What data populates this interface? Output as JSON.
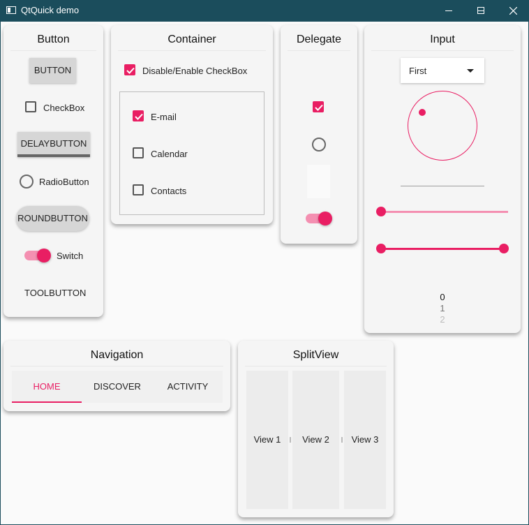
{
  "window": {
    "title": "QtQuick demo"
  },
  "colors": {
    "accent": "#e91e63",
    "accent_light": "#f48fb1",
    "titlebar": "#1b4d5c"
  },
  "icons": {
    "app": "app-window-icon",
    "minimize": "minimize-icon",
    "maximize": "maximize-icon",
    "close": "close-icon",
    "checkmark": "checkmark-icon",
    "dropdown": "caret-down-icon"
  },
  "button_card": {
    "title": "Button",
    "button_label": "BUTTON",
    "checkbox_label": "CheckBox",
    "delay_button_label": "DELAYBUTTON",
    "radio_label": "RadioButton",
    "round_button_label": "ROUNDBUTTON",
    "switch_label": "Switch",
    "tool_button_label": "TOOLBUTTON"
  },
  "container_card": {
    "title": "Container",
    "master_checkbox_label": "Disable/Enable CheckBox",
    "items": [
      {
        "label": "E-mail",
        "checked": true
      },
      {
        "label": "Calendar",
        "checked": false
      },
      {
        "label": "Contacts",
        "checked": false
      }
    ]
  },
  "delegate_card": {
    "title": "Delegate",
    "check_delegate_checked": true,
    "switch_delegate_on": true
  },
  "input_card": {
    "title": "Input",
    "combo_value": "First",
    "slider_value": 0,
    "range_slider": {
      "first": 0,
      "second": 1
    },
    "tumbler_items": [
      "0",
      "1",
      "2"
    ]
  },
  "navigation_card": {
    "title": "Navigation",
    "tabs": [
      {
        "label": "HOME",
        "active": true
      },
      {
        "label": "DISCOVER",
        "active": false
      },
      {
        "label": "ACTIVITY",
        "active": false
      }
    ]
  },
  "splitview_card": {
    "title": "SplitView",
    "views": [
      "View 1",
      "View 2",
      "View 3"
    ]
  }
}
